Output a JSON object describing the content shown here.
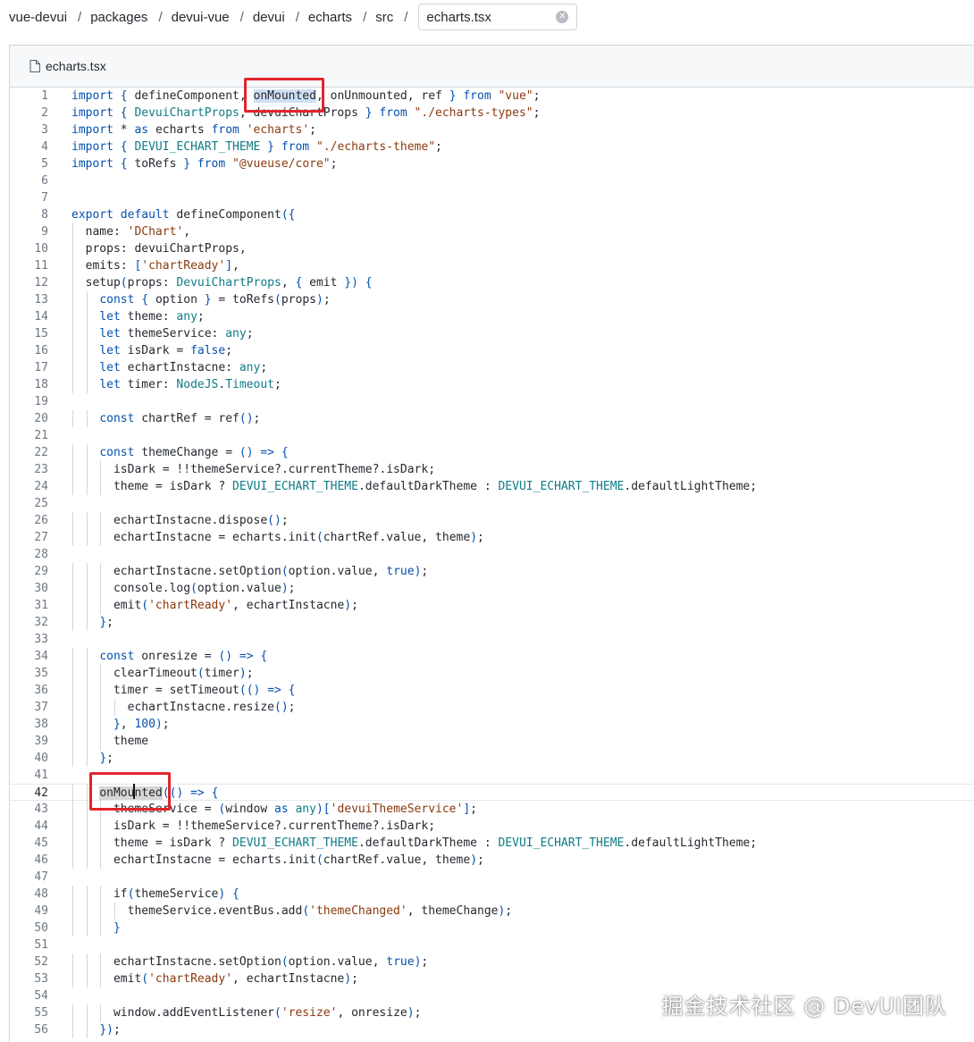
{
  "breadcrumb": {
    "items": [
      "vue-devui",
      "packages",
      "devui-vue",
      "devui",
      "echarts",
      "src"
    ],
    "separator": "/",
    "file_input_value": "echarts.tsx"
  },
  "file": {
    "name": "echarts.tsx",
    "active_line": 42,
    "lines": [
      "import { defineComponent, onMounted, onUnmounted, ref } from \"vue\";",
      "import { DevuiChartProps, devuiChartProps } from \"./echarts-types\";",
      "import * as echarts from 'echarts';",
      "import { DEVUI_ECHART_THEME } from \"./echarts-theme\";",
      "import { toRefs } from \"@vueuse/core\";",
      "",
      "",
      "export default defineComponent({",
      "  name: 'DChart',",
      "  props: devuiChartProps,",
      "  emits: ['chartReady'],",
      "  setup(props: DevuiChartProps, { emit }) {",
      "    const { option } = toRefs(props);",
      "    let theme: any;",
      "    let themeService: any;",
      "    let isDark = false;",
      "    let echartInstacne: any;",
      "    let timer: NodeJS.Timeout;",
      "",
      "    const chartRef = ref();",
      "",
      "    const themeChange = () => {",
      "      isDark = !!themeService?.currentTheme?.isDark;",
      "      theme = isDark ? DEVUI_ECHART_THEME.defaultDarkTheme : DEVUI_ECHART_THEME.defaultLightTheme;",
      "",
      "      echartInstacne.dispose();",
      "      echartInstacne = echarts.init(chartRef.value, theme);",
      "",
      "      echartInstacne.setOption(option.value, true);",
      "      console.log(option.value);",
      "      emit('chartReady', echartInstacne);",
      "    };",
      "",
      "    const onresize = () => {",
      "      clearTimeout(timer);",
      "      timer = setTimeout(() => {",
      "        echartInstacne.resize();",
      "      }, 100);",
      "      theme",
      "    };",
      "",
      "    onMounted(() => {",
      "      themeService = (window as any)['devuiThemeService'];",
      "      isDark = !!themeService?.currentTheme?.isDark;",
      "      theme = isDark ? DEVUI_ECHART_THEME.defaultDarkTheme : DEVUI_ECHART_THEME.defaultLightTheme;",
      "      echartInstacne = echarts.init(chartRef.value, theme);",
      "",
      "      if(themeService) {",
      "        themeService.eventBus.add('themeChanged', themeChange);",
      "      }",
      "",
      "      echartInstacne.setOption(option.value, true);",
      "      emit('chartReady', echartInstacne);",
      "",
      "      window.addEventListener('resize', onresize);",
      "    });"
    ]
  },
  "watermark": "掘金技术社区 @ DevUI团队",
  "colors": {
    "keyword": "#0550ae",
    "string": "#8a3a0f",
    "type": "#0e7c86",
    "highlight_box": "#e3242b"
  },
  "icons": {
    "file": "file-icon",
    "clear": "clear-icon"
  }
}
